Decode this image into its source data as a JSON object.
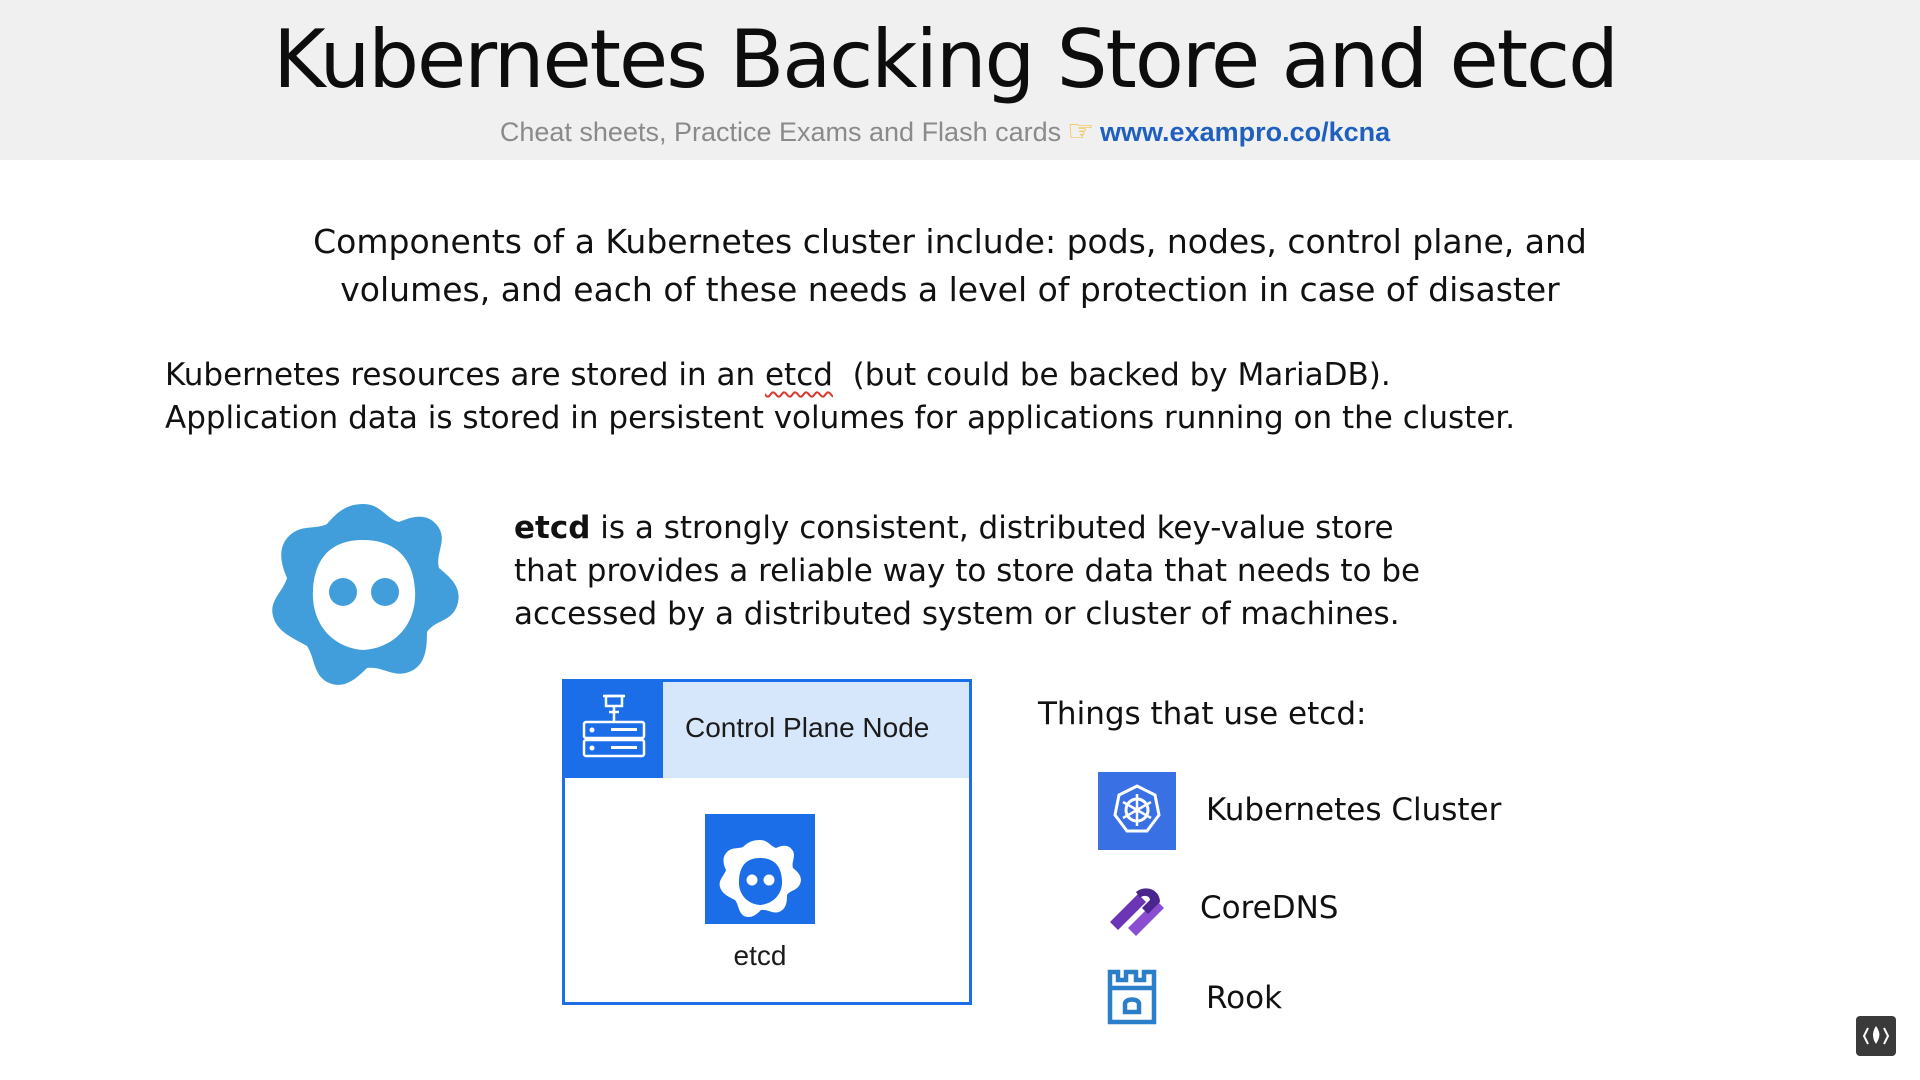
{
  "header": {
    "title": "Kubernetes Backing Store and etcd",
    "subtitle_text": "Cheat sheets, Practice Exams and Flash cards",
    "pointer_icon": "pointing-hand-icon",
    "link_text": "www.exampro.co/kcna"
  },
  "intro": {
    "line1": "Components of a Kubernetes cluster include: pods, nodes, control plane, and",
    "line2": "volumes, and each of these needs a level of protection in case of disaster"
  },
  "storage": {
    "line1_pre": "Kubernetes resources are stored in an ",
    "line1_etcd": "etcd",
    "line1_post": "  (but could be backed by MariaDB).",
    "line2": "Application data is stored in persistent volumes for applications running on the cluster."
  },
  "etcd_description": {
    "bold_term": "etcd",
    "rest": " is a strongly consistent, distributed key-value store that provides a reliable way to store data that needs to be accessed by a distributed system or cluster of machines."
  },
  "diagram": {
    "node_label": "Control Plane Node",
    "etcd_label": "etcd",
    "colors": {
      "accent": "#1c6ee8",
      "header_bg": "#d6e6fb"
    }
  },
  "uses": {
    "heading": "Things that use etcd:",
    "items": [
      {
        "label": "Kubernetes Cluster",
        "icon": "kubernetes-icon"
      },
      {
        "label": "CoreDNS",
        "icon": "coredns-icon"
      },
      {
        "label": "Rook",
        "icon": "rook-icon"
      }
    ]
  },
  "colors": {
    "etcd_logo": "#419eda",
    "link": "#1f5fc0",
    "header_bg": "#f0f0f0"
  }
}
